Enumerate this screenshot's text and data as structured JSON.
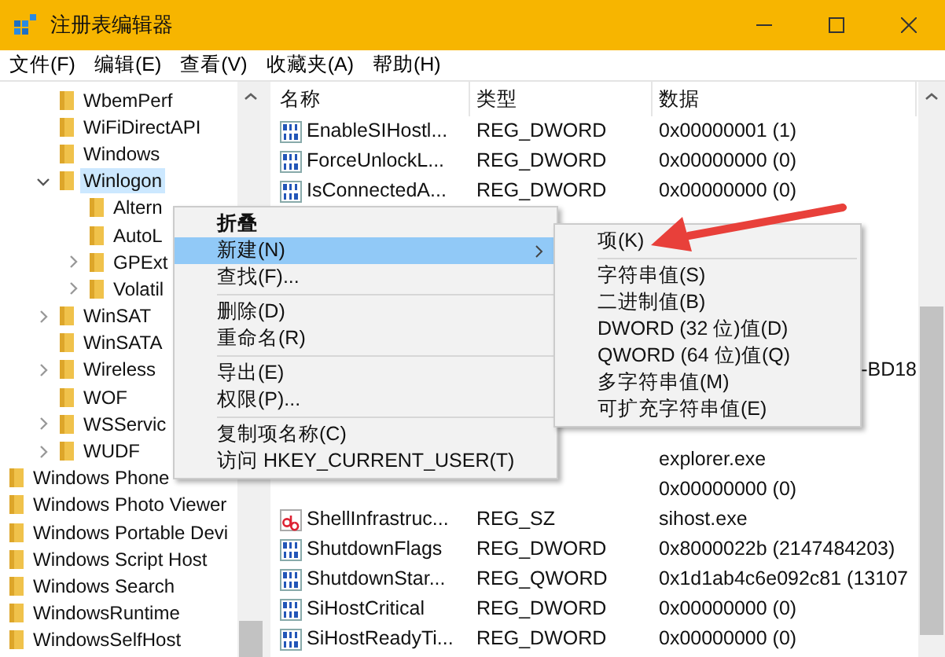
{
  "window": {
    "title": "注册表编辑器"
  },
  "menu_bar": [
    "文件(F)",
    "编辑(E)",
    "查看(V)",
    "收藏夹(A)",
    "帮助(H)"
  ],
  "tree": {
    "items": [
      {
        "children": [
          {
            "label": "WbemPerf",
            "selected": false
          },
          {
            "label": "WiFiDirectAPI",
            "selected": false
          },
          {
            "label": "Windows",
            "selected": false
          },
          {
            "label": "Winlogon",
            "selected": true,
            "expanded": true,
            "children": [
              {
                "label": "Altern",
                "selected": false
              },
              {
                "label": "AutoL",
                "selected": false
              },
              {
                "label": "GPExt",
                "selected": false,
                "expanded": false
              },
              {
                "label": "Volatil",
                "selected": false,
                "expanded": false
              }
            ]
          },
          {
            "label": "WinSAT",
            "selected": false,
            "expanded": false
          },
          {
            "label": "WinSATA",
            "selected": false
          },
          {
            "label": "Wireless",
            "selected": false,
            "expanded": false
          },
          {
            "label": "WOF",
            "selected": false
          },
          {
            "label": "WSServic",
            "selected": false,
            "expanded": false
          },
          {
            "label": "WUDF",
            "selected": false,
            "expanded": false
          }
        ]
      },
      {
        "label": "Windows Phone",
        "selected": false
      },
      {
        "label": "Windows Photo Viewer",
        "selected": false
      },
      {
        "label": "Windows Portable Devi",
        "selected": false
      },
      {
        "label": "Windows Script Host",
        "selected": false
      },
      {
        "label": "Windows Search",
        "selected": false
      },
      {
        "label": "WindowsRuntime",
        "selected": false
      },
      {
        "label": "WindowsSelfHost",
        "selected": false
      }
    ]
  },
  "list": {
    "columns": [
      "名称",
      "类型",
      "数据"
    ],
    "rows": [
      {
        "kind": "binary",
        "name": "EnableSIHostl...",
        "type": "REG_DWORD",
        "data": "0x00000001 (1)"
      },
      {
        "kind": "binary",
        "name": "ForceUnlockL...",
        "type": "REG_DWORD",
        "data": "0x00000000 (0)"
      },
      {
        "kind": "binary",
        "name": "IsConnectedA...",
        "type": "REG_DWORD",
        "data": "0x00000000 (0)"
      },
      {
        "kind": "covered"
      },
      {
        "kind": "covered"
      },
      {
        "kind": "covered"
      },
      {
        "kind": "covered"
      },
      {
        "kind": "covered"
      },
      {
        "kind": "string",
        "data": "-BD18"
      },
      {
        "kind": "covered"
      },
      {
        "kind": "covered"
      },
      {
        "kind": "string",
        "data": "explorer.exe"
      },
      {
        "kind": "binary",
        "data": "0x00000000 (0)"
      },
      {
        "kind": "string",
        "name": "ShellInfrastruc...",
        "type": "REG_SZ",
        "data": "sihost.exe"
      },
      {
        "kind": "binary",
        "name": "ShutdownFlags",
        "type": "REG_DWORD",
        "data": "0x8000022b (2147484203)"
      },
      {
        "kind": "binary",
        "name": "ShutdownStar...",
        "type": "REG_QWORD",
        "data": "0x1d1ab4c6e092c81 (13107"
      },
      {
        "kind": "binary",
        "name": "SiHostCritical",
        "type": "REG_DWORD",
        "data": "0x00000000 (0)"
      },
      {
        "kind": "binary",
        "name": "SiHostReadyTi...",
        "type": "REG_DWORD",
        "data": "0x00000000 (0)"
      }
    ]
  },
  "context_menu": {
    "items": [
      {
        "kind": "default",
        "label": "折叠",
        "selected": false
      },
      {
        "kind": "item",
        "label": "新建(N)",
        "selected": true,
        "submenu": {
          "items": [
            {
              "kind": "item",
              "label": "项(K)",
              "selected": false
            },
            {
              "kind": "separator"
            },
            {
              "kind": "item",
              "label": "字符串值(S)",
              "selected": false
            },
            {
              "kind": "item",
              "label": "二进制值(B)",
              "selected": false
            },
            {
              "kind": "item",
              "label": "DWORD (32 位)值(D)",
              "selected": false
            },
            {
              "kind": "item",
              "label": "QWORD (64 位)值(Q)",
              "selected": false
            },
            {
              "kind": "item",
              "label": "多字符串值(M)",
              "selected": false
            },
            {
              "kind": "item",
              "label": "可扩充字符串值(E)",
              "selected": false
            }
          ]
        }
      },
      {
        "kind": "item",
        "label": "查找(F)...",
        "selected": false
      },
      {
        "kind": "separator"
      },
      {
        "kind": "item",
        "label": "删除(D)",
        "selected": false
      },
      {
        "kind": "item",
        "label": "重命名(R)",
        "selected": false
      },
      {
        "kind": "separator"
      },
      {
        "kind": "item",
        "label": "导出(E)",
        "selected": false
      },
      {
        "kind": "item",
        "label": "权限(P)...",
        "selected": false
      },
      {
        "kind": "separator"
      },
      {
        "kind": "item",
        "label": "复制项名称(C)",
        "selected": false
      },
      {
        "kind": "item",
        "label": "访问 HKEY_CURRENT_USER(T)",
        "selected": false
      }
    ]
  }
}
